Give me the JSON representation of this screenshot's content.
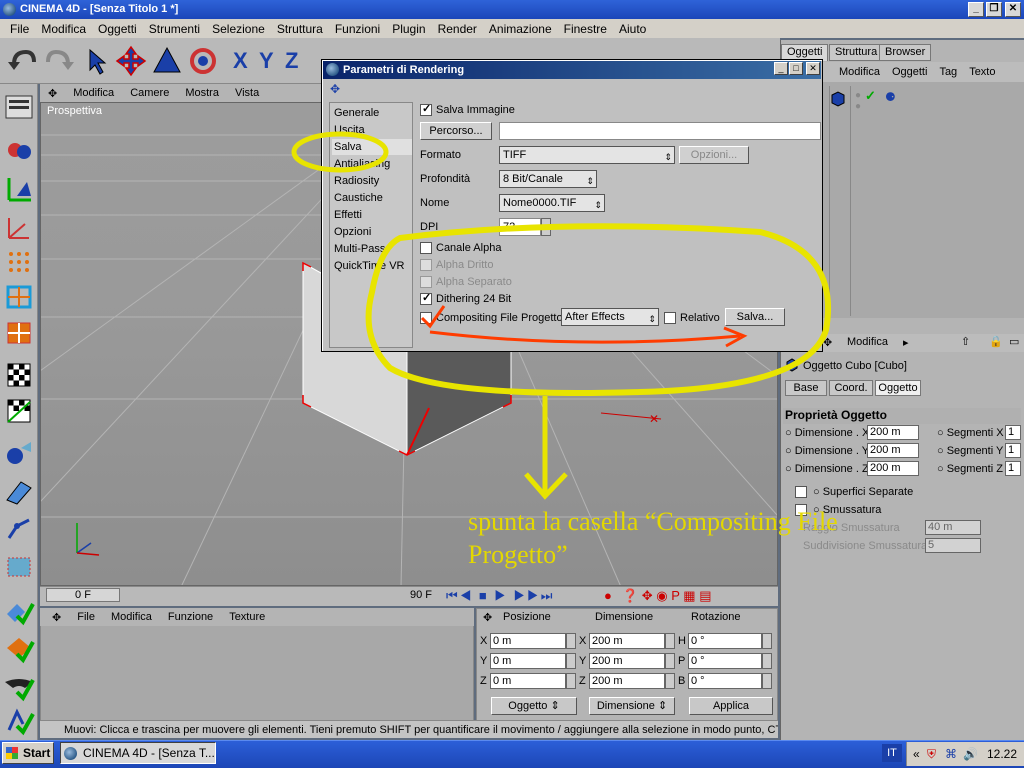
{
  "window": {
    "title": "CINEMA 4D - [Senza Titolo 1 *]",
    "min": "_",
    "max": "❐",
    "close": "✕"
  },
  "menubar": [
    "File",
    "Modifica",
    "Oggetti",
    "Strumenti",
    "Selezione",
    "Struttura",
    "Funzioni",
    "Plugin",
    "Render",
    "Animazione",
    "Finestre",
    "Aiuto"
  ],
  "viewport": {
    "menu": [
      "Modifica",
      "Camere",
      "Mostra",
      "Vista"
    ],
    "label": "Prospettiva"
  },
  "timeline": {
    "start": "0 F",
    "end": "90 F"
  },
  "material_manager": {
    "menu": [
      "File",
      "Modifica",
      "Funzione",
      "Texture"
    ]
  },
  "coordinates": {
    "headers": [
      "Posizione",
      "Dimensione",
      "Rotazione"
    ],
    "pos_labels": [
      "X",
      "Y",
      "Z"
    ],
    "size_labels": [
      "X",
      "Y",
      "Z"
    ],
    "rot_labels": [
      "H",
      "P",
      "B"
    ],
    "pos_values": [
      "0 m",
      "0 m",
      "0 m"
    ],
    "size_values": [
      "200 m",
      "200 m",
      "200 m"
    ],
    "rot_values": [
      "0 °",
      "0 °",
      "0 °"
    ],
    "mode_object": "Oggetto",
    "mode_size": "Dimensione",
    "apply": "Applica"
  },
  "status": "Muovi: Clicca e trascina per muovere gli elementi. Tieni premuto SHIFT per quantificare il movimento / aggiungere alla selezione in modo punto, CTRL per",
  "right_panel": {
    "tabs": [
      "Oggetti",
      "Struttura",
      "Browser"
    ],
    "menu": [
      "Modifica",
      "Oggetti",
      "Tag",
      "Texto"
    ],
    "attr_menu": "Modifica",
    "object_title": "Oggetto Cubo [Cubo]",
    "attr_tabs": [
      "Base",
      "Coord.",
      "Oggetto"
    ],
    "section": "Proprietà Oggetto",
    "dimensions": [
      {
        "label": "Dimensione . X",
        "value": "200 m",
        "seg_label": "Segmenti X",
        "seg": "1"
      },
      {
        "label": "Dimensione . Y",
        "value": "200 m",
        "seg_label": "Segmenti Y",
        "seg": "1"
      },
      {
        "label": "Dimensione . Z",
        "value": "200 m",
        "seg_label": "Segmenti Z",
        "seg": "1"
      }
    ],
    "surfaces": "Superfici Separate",
    "smooth": "Smussatura",
    "smooth_radius": "Raggio Smussatura",
    "smooth_radius_val": "40 m",
    "smooth_subdiv": "Suddivisione Smussatura",
    "smooth_subdiv_val": "5"
  },
  "dialog": {
    "title": "Parametri di Rendering",
    "nav": [
      "Generale",
      "Uscita",
      "Salva",
      "Antialiasing",
      "Radiosity",
      "Caustiche",
      "Effetti",
      "Opzioni",
      "Multi-Pass",
      "QuickTime VR"
    ],
    "save_image": "Salva Immagine",
    "path_btn": "Percorso...",
    "path_value": "",
    "format_label": "Formato",
    "format_value": "TIFF",
    "options_btn": "Opzioni...",
    "depth_label": "Profondità",
    "depth_value": "8 Bit/Canale",
    "name_label": "Nome",
    "name_value": "Nome0000.TIF",
    "dpi_label": "DPI",
    "dpi_value": "72",
    "alpha": "Canale Alpha",
    "alpha_straight": "Alpha Dritto",
    "alpha_separate": "Alpha Separato",
    "dithering": "Dithering 24 Bit",
    "compositing": "Compositing File Progetto",
    "compositing_app": "After Effects",
    "relative": "Relativo",
    "save_btn": "Salva..."
  },
  "annotation": "spunta la casella “Compositing File Progetto”",
  "taskbar": {
    "start": "Start",
    "task": "CINEMA 4D - [Senza T...",
    "lang": "IT",
    "clock": "12.22"
  },
  "colors": {
    "annotation_yellow": "#e8e400",
    "annotation_red": "#ff3c00",
    "title_blue": "#1b46b9"
  }
}
